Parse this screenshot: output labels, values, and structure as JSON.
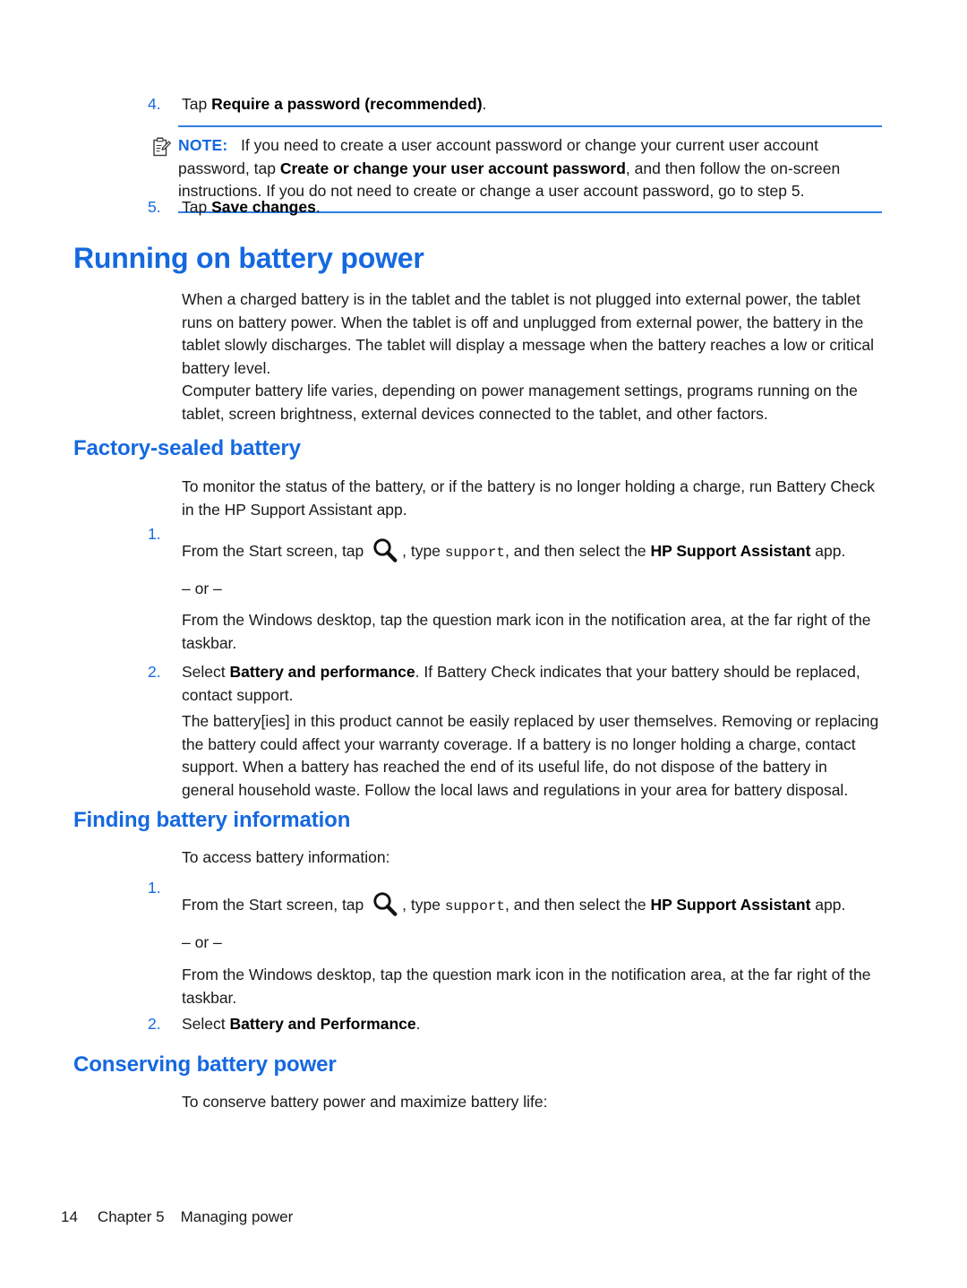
{
  "document": {
    "page_number": "14",
    "chapter": "Chapter 5",
    "chapter_title": "Managing power"
  },
  "colors": {
    "heading_blue": "#1569e0",
    "note_rule_blue": "#2f7fe0",
    "body_text": "#1a1a1a"
  },
  "steps_top": {
    "step4": {
      "number": "4.",
      "lead": "Tap ",
      "bold": "Require a password (recommended)",
      "tail": "."
    },
    "step5": {
      "number": "5.",
      "lead": "Tap ",
      "bold": "Save changes",
      "tail": "."
    }
  },
  "note": {
    "icon": "note-clipboard-icon",
    "label": "NOTE:",
    "text_part1": "If you need to create a user account password or change your current user account password, tap ",
    "bold1": "Create or change your user account password",
    "text_part2": ", and then follow the on-screen instructions. If you do not need to create or change a user account password, go to step 5."
  },
  "section_main": {
    "title": "Running on battery power",
    "paragraph1": "When a charged battery is in the tablet and the tablet is not plugged into external power, the tablet runs on battery power. When the tablet is off and unplugged from external power, the battery in the tablet slowly discharges. The tablet will display a message when the battery reaches a low or critical battery level.",
    "paragraph2": "Computer battery life varies, depending on power management settings, programs running on the tablet, screen brightness, external devices connected to the tablet, and other factors."
  },
  "section_factory": {
    "title": "Factory-sealed battery",
    "intro": "To monitor the status of the battery, or if the battery is no longer holding a charge, run Battery Check in the HP Support Assistant app.",
    "step1": {
      "number": "1.",
      "lead": "From the Start screen, tap ",
      "icon": "search-magnifier-icon",
      "mid": ", type ",
      "mono": "support",
      "tail_lead": ", and then select the ",
      "bold": "HP Support Assistant",
      "tail": " app."
    },
    "or_divider": "– or –",
    "alt_text": "From the Windows desktop, tap the question mark icon in the notification area, at the far right of the taskbar.",
    "step2": {
      "number": "2.",
      "lead": "Select ",
      "bold": "Battery and performance",
      "tail": ". If Battery Check indicates that your battery should be replaced, contact support."
    },
    "closing": "The battery[ies] in this product cannot be easily replaced by user themselves. Removing or replacing the battery could affect your warranty coverage. If a battery is no longer holding a charge, contact support. When a battery has reached the end of its useful life, do not dispose of the battery in general household waste. Follow the local laws and regulations in your area for battery disposal."
  },
  "section_finding": {
    "title": "Finding battery information",
    "intro": "To access battery information:",
    "step1": {
      "number": "1.",
      "lead": "From the Start screen, tap ",
      "icon": "search-magnifier-icon",
      "mid": ", type ",
      "mono": "support",
      "tail_lead": ", and then select the ",
      "bold": "HP Support Assistant",
      "tail": " app."
    },
    "or_divider": "– or –",
    "alt_text": "From the Windows desktop, tap the question mark icon in the notification area, at the far right of the taskbar.",
    "step2": {
      "number": "2.",
      "lead": "Select ",
      "bold": "Battery and Performance",
      "tail": "."
    }
  },
  "section_conserving": {
    "title": "Conserving battery power",
    "intro": "To conserve battery power and maximize battery life:"
  }
}
